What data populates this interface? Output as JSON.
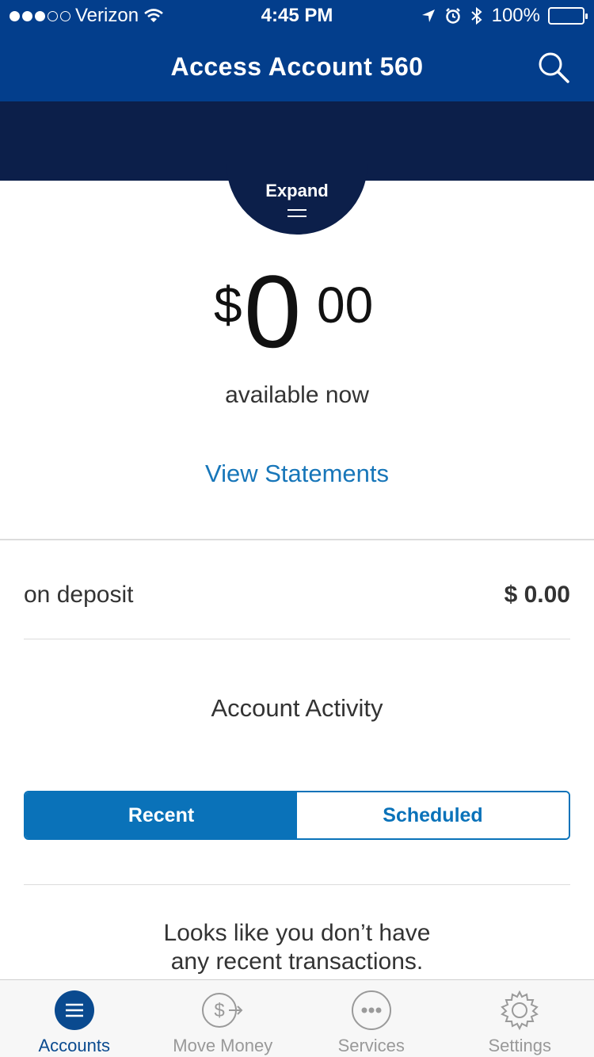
{
  "status_bar": {
    "carrier": "Verizon",
    "time": "4:45 PM",
    "battery": "100%"
  },
  "header": {
    "title": "Access Account 560"
  },
  "expand": {
    "label": "Expand"
  },
  "balance": {
    "currency_symbol": "$",
    "whole": "0",
    "cents": "00",
    "caption": "available now"
  },
  "links": {
    "view_statements": "View Statements"
  },
  "deposit": {
    "label": "on deposit",
    "value": "$ 0.00"
  },
  "activity": {
    "title": "Account Activity",
    "tabs": [
      "Recent",
      "Scheduled"
    ],
    "selected_tab": "Recent",
    "empty_line1": "Looks like you don’t have",
    "empty_line2": "any recent transactions."
  },
  "tab_bar": {
    "items": [
      {
        "label": "Accounts",
        "icon": "menu-icon"
      },
      {
        "label": "Move Money",
        "icon": "dollar-arrow-icon"
      },
      {
        "label": "Services",
        "icon": "more-icon"
      },
      {
        "label": "Settings",
        "icon": "gear-icon"
      }
    ],
    "active": "Accounts"
  },
  "colors": {
    "header_blue": "#033e8c",
    "dark_navy": "#0c1f4a",
    "accent": "#0a72b9",
    "link": "#1776b9"
  }
}
